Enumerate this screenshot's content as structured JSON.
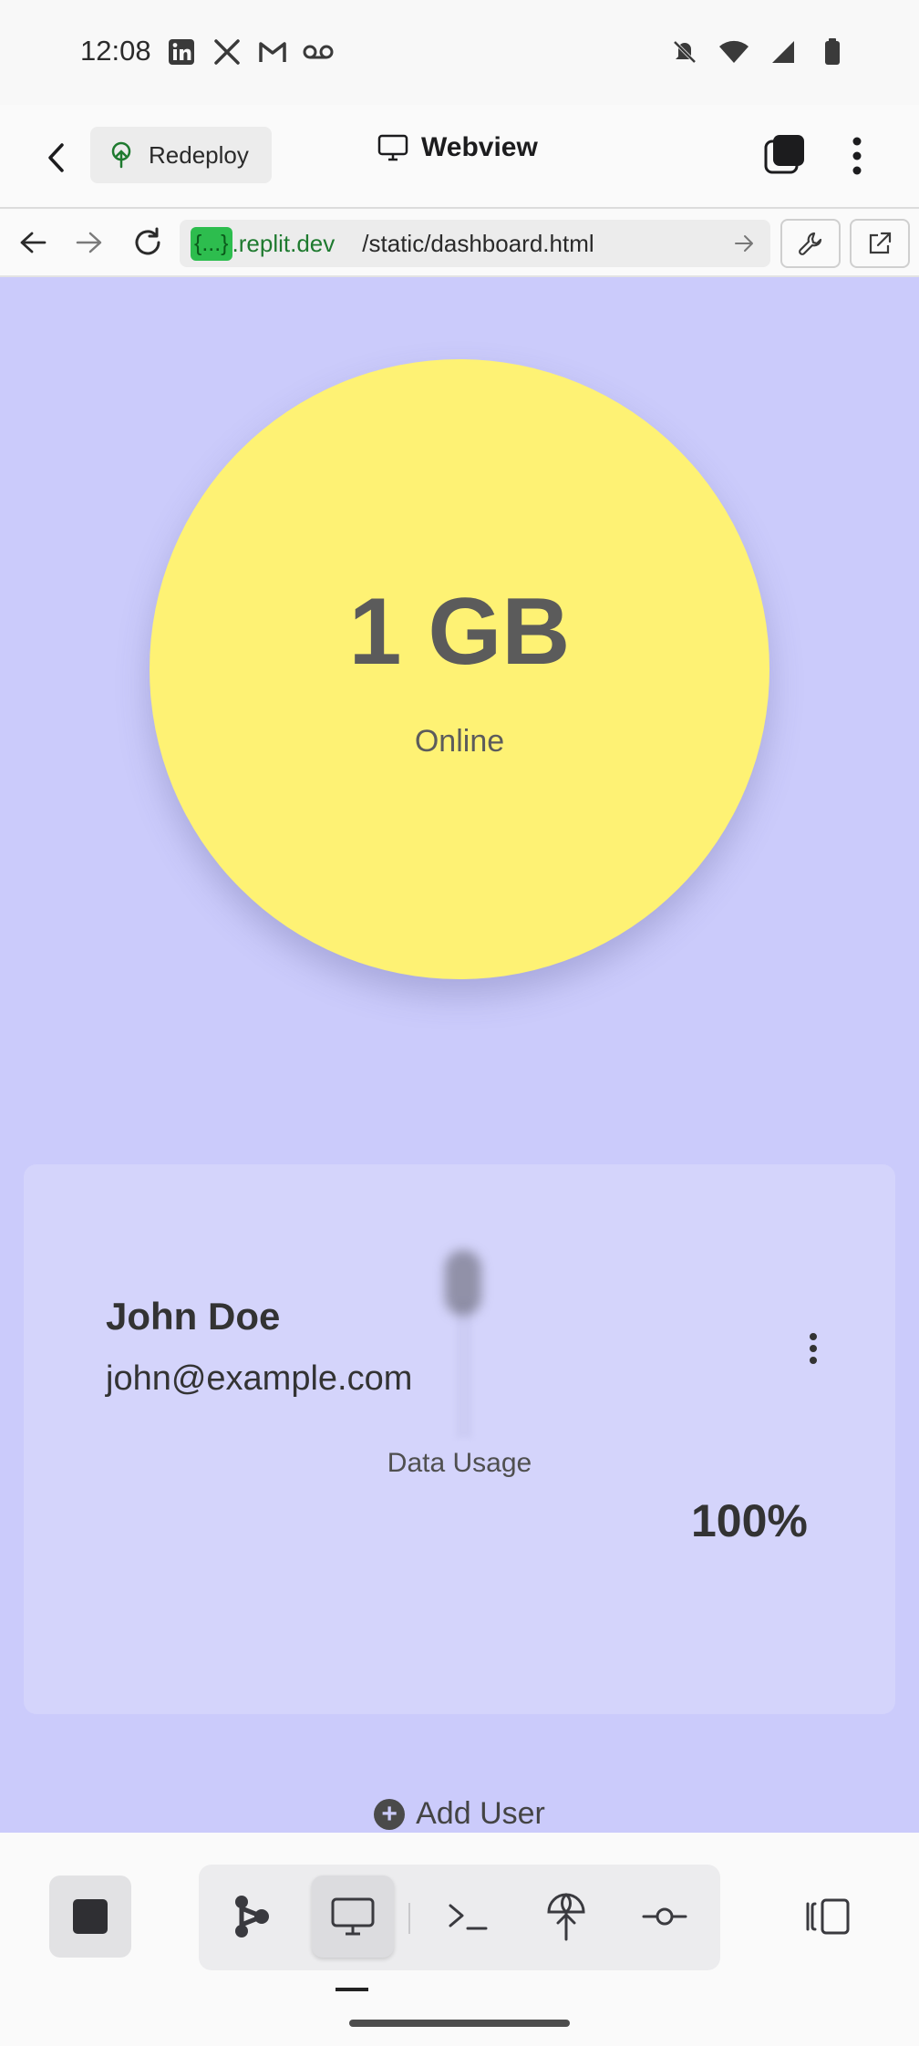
{
  "status_bar": {
    "time": "12:08",
    "left_icons": [
      "linkedin-icon",
      "x-icon",
      "gmail-icon",
      "voicemail-icon"
    ],
    "right_icons": [
      "mute-icon",
      "wifi-icon",
      "signal-icon",
      "battery-icon"
    ]
  },
  "header": {
    "redeploy_label": "Redeploy",
    "title": "Webview"
  },
  "url_bar": {
    "domain_chip": "{...}",
    "domain": ".replit.dev",
    "path": "/static/dashboard.html"
  },
  "dashboard": {
    "usage_value": "1 GB",
    "usage_status": "Online",
    "user": {
      "name": "John Doe",
      "email": "john@example.com",
      "data_usage_label": "Data Usage",
      "data_usage_percent": "100%"
    },
    "add_user_label": "Add User"
  },
  "bottom_bar": {
    "tools": [
      "stop-icon",
      "graph-icon",
      "webview-icon",
      "shell-icon",
      "deploy-icon",
      "git-icon",
      "panel-icon"
    ],
    "active_tool": "webview-icon"
  },
  "colors": {
    "page_background": "#cbcbfb",
    "circle": "#fef274",
    "card": "#d4d4fb",
    "domain_chip": "#2dbd4e",
    "domain_text": "#1e7a2f"
  }
}
